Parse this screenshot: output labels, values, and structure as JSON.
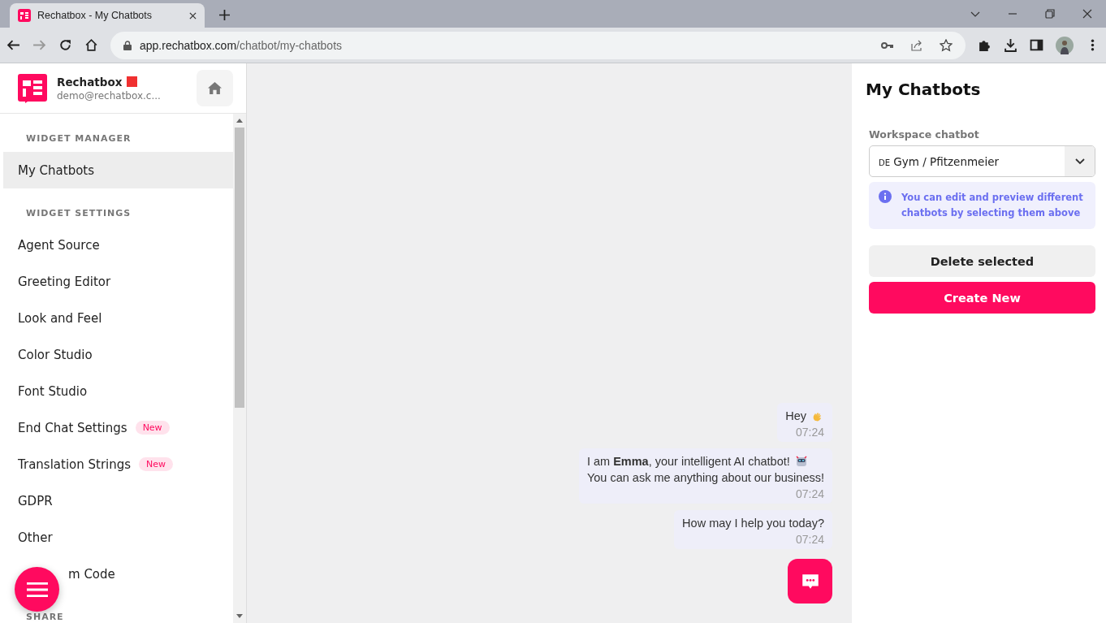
{
  "browser": {
    "tab_title": "Rechatbox - My Chatbots",
    "url_host": "app.rechatbox.com",
    "url_path": "/chatbot/my-chatbots"
  },
  "account": {
    "name": "Rechatbox",
    "email": "demo@rechatbox.c..."
  },
  "sidebar": {
    "sections": [
      {
        "heading": "WIDGET MANAGER",
        "items": [
          {
            "label": "My Chatbots",
            "selected": true
          }
        ]
      },
      {
        "heading": "WIDGET SETTINGS",
        "items": [
          {
            "label": "Agent Source",
            "selected": false
          },
          {
            "label": "Greeting Editor",
            "selected": false
          },
          {
            "label": "Look and Feel",
            "selected": false
          },
          {
            "label": "Color Studio",
            "selected": false
          },
          {
            "label": "Font Studio",
            "selected": false
          },
          {
            "label": "End Chat Settings",
            "selected": false,
            "badge": "New"
          },
          {
            "label": "Translation Strings",
            "selected": false,
            "badge": "New"
          },
          {
            "label": "GDPR",
            "selected": false
          },
          {
            "label": "Other",
            "selected": false
          },
          {
            "label": "m Code",
            "selected": false,
            "kind": "covered"
          }
        ]
      },
      {
        "heading": "SHARE"
      }
    ]
  },
  "chat": {
    "messages": [
      {
        "kind": "greeting",
        "lines": [
          "Hey"
        ],
        "time": "07:24"
      },
      {
        "kind": "intro",
        "lines": [
          "I am **Emma**, your intelligent AI chatbot!",
          "You can ask me anything about our business!"
        ],
        "time": "07:24"
      },
      {
        "kind": "question",
        "lines": [
          "How may I help you today?"
        ],
        "time": "07:24"
      }
    ]
  },
  "panel": {
    "title": "My Chatbots",
    "field_label": "Workspace chatbot",
    "select": {
      "flag": "DE",
      "value": "Gym / Pfitzenmeier"
    },
    "info": "You can edit and preview different chatbots by selecting them above",
    "buttons": [
      {
        "label": "Delete selected",
        "kind": "secondary"
      },
      {
        "label": "Create New",
        "kind": "primary"
      }
    ]
  }
}
